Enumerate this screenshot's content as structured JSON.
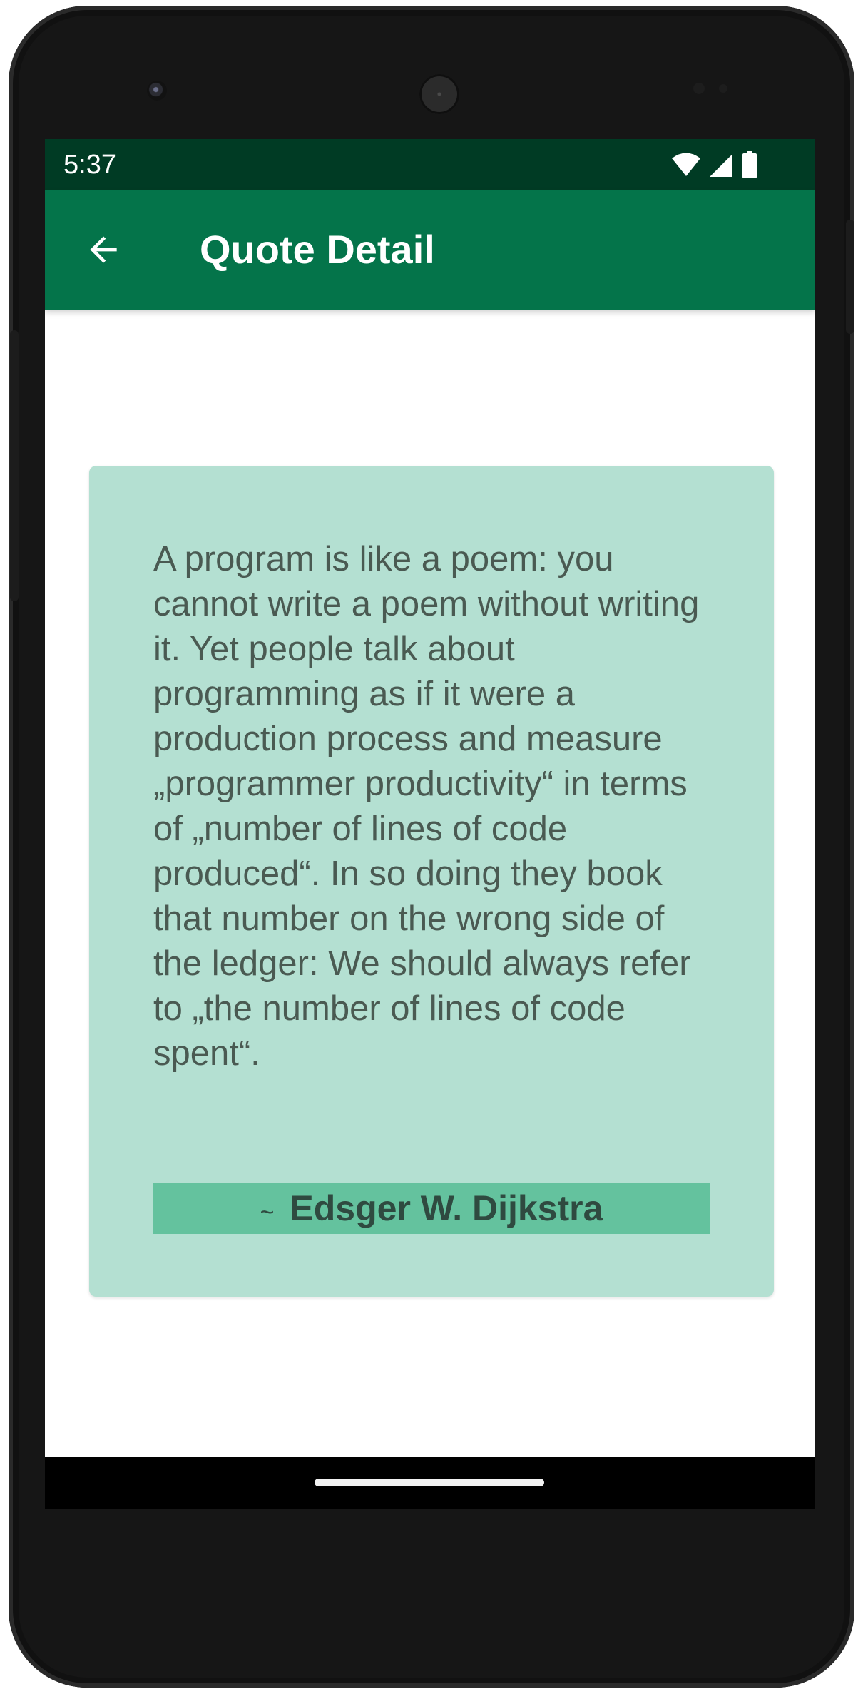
{
  "status_bar": {
    "time": "5:37",
    "icons": [
      "wifi-icon",
      "signal-icon",
      "battery-icon"
    ]
  },
  "app_bar": {
    "title": "Quote Detail",
    "back_icon": "arrow-back-icon"
  },
  "quote": {
    "text": "A program is like a poem: you cannot write a poem without writing it. Yet people talk about programming as if it were a production process and measure „programmer productivity“ in terms of „number of lines of code produced“. In so doing they book that number on the wrong side of the ledger: We should always refer to „the number of lines of code spent“.",
    "author_prefix": "~",
    "author": "Edsger W. Dijkstra"
  },
  "colors": {
    "status_bar": "#003b24",
    "app_bar": "#04744a",
    "card_background": "#b4e0d2",
    "author_background": "#64c29e",
    "quote_text": "#4a5a52"
  }
}
